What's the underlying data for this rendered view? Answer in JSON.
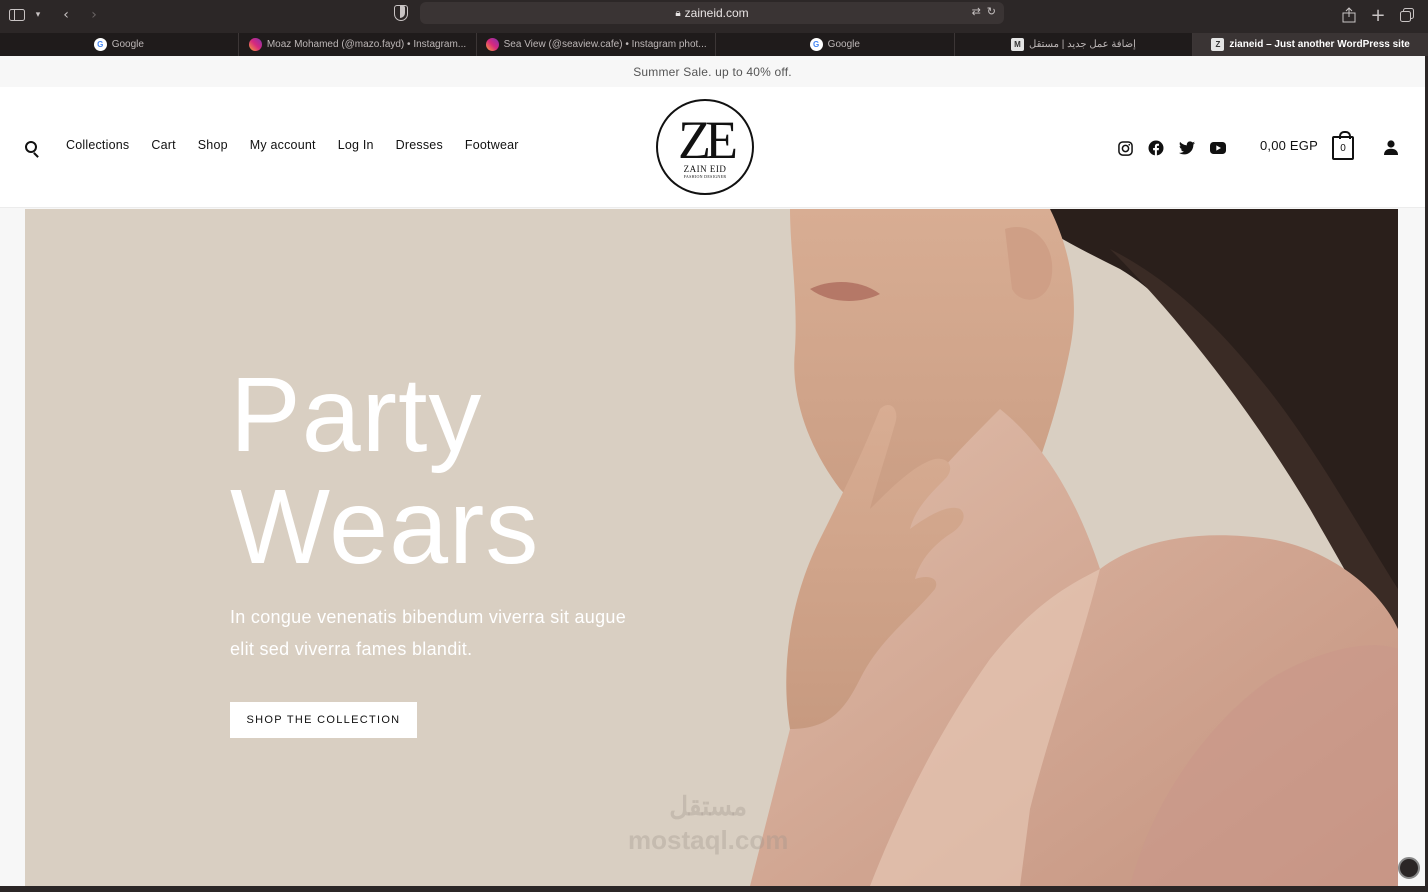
{
  "browser": {
    "url": "zaineid.com",
    "tabs": [
      {
        "title": "Google",
        "favicon": "google-icon"
      },
      {
        "title": "Moaz Mohamed (@mazo.fayd) • Instagram...",
        "favicon": "instagram-icon"
      },
      {
        "title": "Sea View (@seaview.cafe) • Instagram phot...",
        "favicon": "instagram-icon"
      },
      {
        "title": "Google",
        "favicon": "google-icon"
      },
      {
        "title": "إضافة عمل جديد | مستقل",
        "favicon": "mostaql-icon"
      },
      {
        "title": "zianeid – Just another WordPress site",
        "favicon": "wordpress-icon"
      }
    ]
  },
  "announcement": "Summer Sale. up to 40% off.",
  "header": {
    "nav": [
      "Collections",
      "Cart",
      "Shop",
      "My account",
      "Log In",
      "Dresses",
      "Footwear"
    ],
    "logo": {
      "mark": "ZE",
      "name": "ZAIN EID",
      "tagline": "FASHION DESIGNER"
    },
    "social": [
      "instagram-icon",
      "facebook-icon",
      "twitter-icon",
      "youtube-icon"
    ],
    "cart_total": "0,00 EGP",
    "cart_count": "0"
  },
  "hero": {
    "title_line1": "Party",
    "title_line2": "Wears",
    "subtitle": "In congue venenatis bibendum viverra sit augue elit sed viverra fames blandit.",
    "button": "SHOP THE COLLECTION"
  },
  "watermark": {
    "arabic": "مستقل",
    "latin": "mostaql.com"
  },
  "colors": {
    "hero_bg": "#d9cfc2",
    "chrome": "#2c2727",
    "text": "#111111"
  }
}
